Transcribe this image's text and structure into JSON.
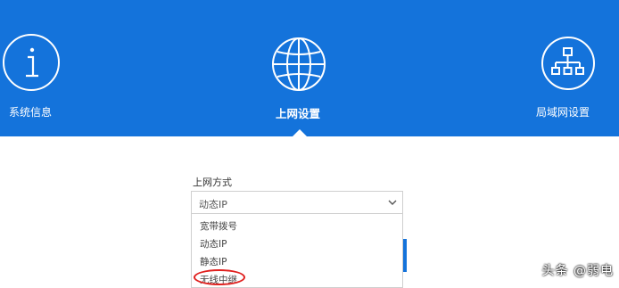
{
  "nav": {
    "items": [
      {
        "label": "系统信息",
        "icon": "info-icon"
      },
      {
        "label": "上网设置",
        "icon": "globe-icon",
        "active": true
      },
      {
        "label": "局域网设置",
        "icon": "network-icon"
      }
    ]
  },
  "form": {
    "field_label": "上网方式",
    "selected_value": "动态IP",
    "options": [
      "宽带拨号",
      "动态IP",
      "静态IP",
      "无线中继"
    ],
    "highlighted_option": "无线中继"
  },
  "watermark": "头条 @弱电",
  "colors": {
    "banner": "#1473db",
    "highlight_circle": "#e0201e"
  }
}
